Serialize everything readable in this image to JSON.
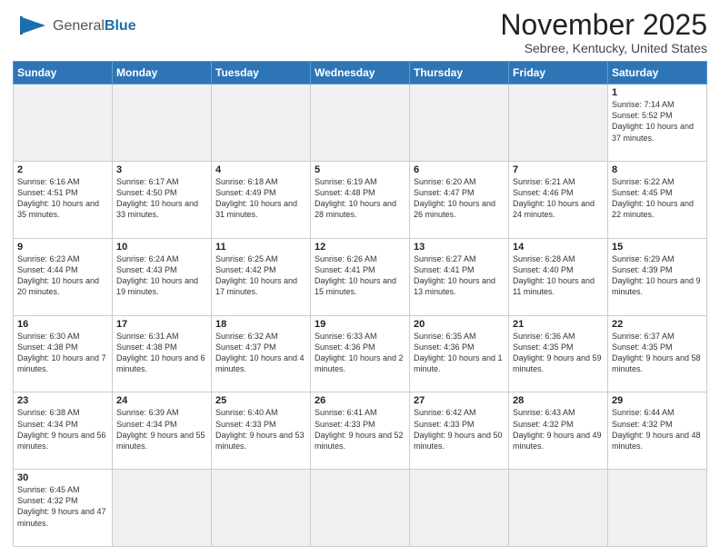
{
  "header": {
    "logo_general": "General",
    "logo_blue": "Blue",
    "month_title": "November 2025",
    "subtitle": "Sebree, Kentucky, United States"
  },
  "days_of_week": [
    "Sunday",
    "Monday",
    "Tuesday",
    "Wednesday",
    "Thursday",
    "Friday",
    "Saturday"
  ],
  "weeks": [
    [
      {
        "day": "",
        "empty": true
      },
      {
        "day": "",
        "empty": true
      },
      {
        "day": "",
        "empty": true
      },
      {
        "day": "",
        "empty": true
      },
      {
        "day": "",
        "empty": true
      },
      {
        "day": "",
        "empty": true
      },
      {
        "day": "1",
        "sunrise": "Sunrise: 7:14 AM",
        "sunset": "Sunset: 5:52 PM",
        "daylight": "Daylight: 10 hours and 37 minutes."
      }
    ],
    [
      {
        "day": "2",
        "sunrise": "Sunrise: 6:16 AM",
        "sunset": "Sunset: 4:51 PM",
        "daylight": "Daylight: 10 hours and 35 minutes."
      },
      {
        "day": "3",
        "sunrise": "Sunrise: 6:17 AM",
        "sunset": "Sunset: 4:50 PM",
        "daylight": "Daylight: 10 hours and 33 minutes."
      },
      {
        "day": "4",
        "sunrise": "Sunrise: 6:18 AM",
        "sunset": "Sunset: 4:49 PM",
        "daylight": "Daylight: 10 hours and 31 minutes."
      },
      {
        "day": "5",
        "sunrise": "Sunrise: 6:19 AM",
        "sunset": "Sunset: 4:48 PM",
        "daylight": "Daylight: 10 hours and 28 minutes."
      },
      {
        "day": "6",
        "sunrise": "Sunrise: 6:20 AM",
        "sunset": "Sunset: 4:47 PM",
        "daylight": "Daylight: 10 hours and 26 minutes."
      },
      {
        "day": "7",
        "sunrise": "Sunrise: 6:21 AM",
        "sunset": "Sunset: 4:46 PM",
        "daylight": "Daylight: 10 hours and 24 minutes."
      },
      {
        "day": "8",
        "sunrise": "Sunrise: 6:22 AM",
        "sunset": "Sunset: 4:45 PM",
        "daylight": "Daylight: 10 hours and 22 minutes."
      }
    ],
    [
      {
        "day": "9",
        "sunrise": "Sunrise: 6:23 AM",
        "sunset": "Sunset: 4:44 PM",
        "daylight": "Daylight: 10 hours and 20 minutes."
      },
      {
        "day": "10",
        "sunrise": "Sunrise: 6:24 AM",
        "sunset": "Sunset: 4:43 PM",
        "daylight": "Daylight: 10 hours and 19 minutes."
      },
      {
        "day": "11",
        "sunrise": "Sunrise: 6:25 AM",
        "sunset": "Sunset: 4:42 PM",
        "daylight": "Daylight: 10 hours and 17 minutes."
      },
      {
        "day": "12",
        "sunrise": "Sunrise: 6:26 AM",
        "sunset": "Sunset: 4:41 PM",
        "daylight": "Daylight: 10 hours and 15 minutes."
      },
      {
        "day": "13",
        "sunrise": "Sunrise: 6:27 AM",
        "sunset": "Sunset: 4:41 PM",
        "daylight": "Daylight: 10 hours and 13 minutes."
      },
      {
        "day": "14",
        "sunrise": "Sunrise: 6:28 AM",
        "sunset": "Sunset: 4:40 PM",
        "daylight": "Daylight: 10 hours and 11 minutes."
      },
      {
        "day": "15",
        "sunrise": "Sunrise: 6:29 AM",
        "sunset": "Sunset: 4:39 PM",
        "daylight": "Daylight: 10 hours and 9 minutes."
      }
    ],
    [
      {
        "day": "16",
        "sunrise": "Sunrise: 6:30 AM",
        "sunset": "Sunset: 4:38 PM",
        "daylight": "Daylight: 10 hours and 7 minutes."
      },
      {
        "day": "17",
        "sunrise": "Sunrise: 6:31 AM",
        "sunset": "Sunset: 4:38 PM",
        "daylight": "Daylight: 10 hours and 6 minutes."
      },
      {
        "day": "18",
        "sunrise": "Sunrise: 6:32 AM",
        "sunset": "Sunset: 4:37 PM",
        "daylight": "Daylight: 10 hours and 4 minutes."
      },
      {
        "day": "19",
        "sunrise": "Sunrise: 6:33 AM",
        "sunset": "Sunset: 4:36 PM",
        "daylight": "Daylight: 10 hours and 2 minutes."
      },
      {
        "day": "20",
        "sunrise": "Sunrise: 6:35 AM",
        "sunset": "Sunset: 4:36 PM",
        "daylight": "Daylight: 10 hours and 1 minute."
      },
      {
        "day": "21",
        "sunrise": "Sunrise: 6:36 AM",
        "sunset": "Sunset: 4:35 PM",
        "daylight": "Daylight: 9 hours and 59 minutes."
      },
      {
        "day": "22",
        "sunrise": "Sunrise: 6:37 AM",
        "sunset": "Sunset: 4:35 PM",
        "daylight": "Daylight: 9 hours and 58 minutes."
      }
    ],
    [
      {
        "day": "23",
        "sunrise": "Sunrise: 6:38 AM",
        "sunset": "Sunset: 4:34 PM",
        "daylight": "Daylight: 9 hours and 56 minutes."
      },
      {
        "day": "24",
        "sunrise": "Sunrise: 6:39 AM",
        "sunset": "Sunset: 4:34 PM",
        "daylight": "Daylight: 9 hours and 55 minutes."
      },
      {
        "day": "25",
        "sunrise": "Sunrise: 6:40 AM",
        "sunset": "Sunset: 4:33 PM",
        "daylight": "Daylight: 9 hours and 53 minutes."
      },
      {
        "day": "26",
        "sunrise": "Sunrise: 6:41 AM",
        "sunset": "Sunset: 4:33 PM",
        "daylight": "Daylight: 9 hours and 52 minutes."
      },
      {
        "day": "27",
        "sunrise": "Sunrise: 6:42 AM",
        "sunset": "Sunset: 4:33 PM",
        "daylight": "Daylight: 9 hours and 50 minutes."
      },
      {
        "day": "28",
        "sunrise": "Sunrise: 6:43 AM",
        "sunset": "Sunset: 4:32 PM",
        "daylight": "Daylight: 9 hours and 49 minutes."
      },
      {
        "day": "29",
        "sunrise": "Sunrise: 6:44 AM",
        "sunset": "Sunset: 4:32 PM",
        "daylight": "Daylight: 9 hours and 48 minutes."
      }
    ],
    [
      {
        "day": "30",
        "sunrise": "Sunrise: 6:45 AM",
        "sunset": "Sunset: 4:32 PM",
        "daylight": "Daylight: 9 hours and 47 minutes."
      },
      {
        "day": "",
        "empty": true
      },
      {
        "day": "",
        "empty": true
      },
      {
        "day": "",
        "empty": true
      },
      {
        "day": "",
        "empty": true
      },
      {
        "day": "",
        "empty": true
      },
      {
        "day": "",
        "empty": true
      }
    ]
  ]
}
